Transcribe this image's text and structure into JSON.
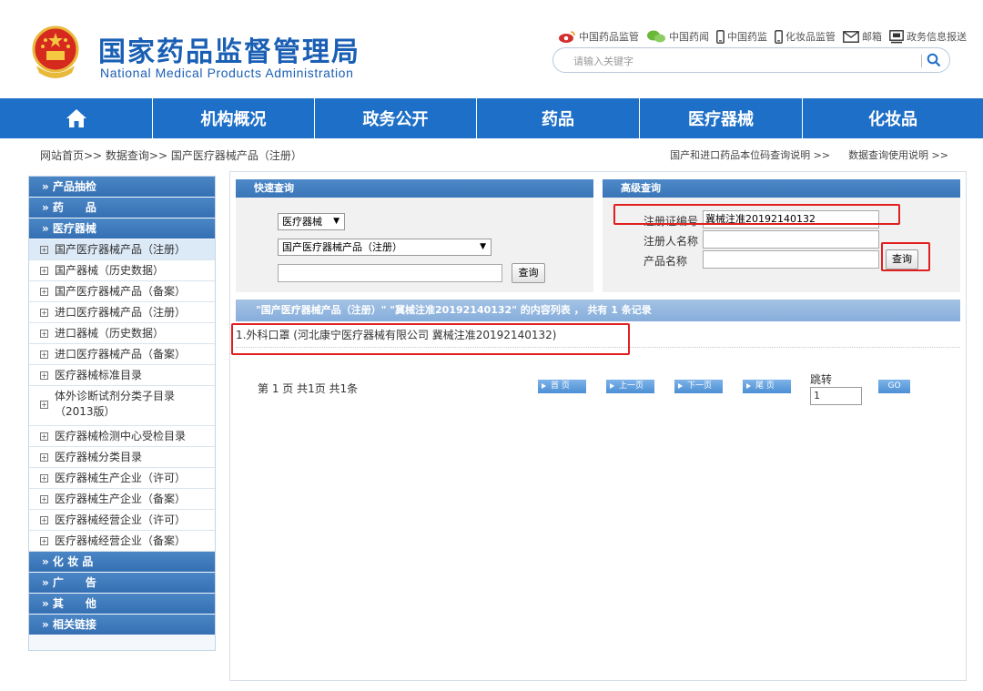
{
  "header": {
    "title": "国家药品监督管理局",
    "subtitle": "National Medical Products Administration",
    "links": [
      {
        "icon": "weibo-icon",
        "label": "中国药品监管"
      },
      {
        "icon": "wechat-icon",
        "label": "中国药闻"
      },
      {
        "icon": "mobile-icon",
        "label": "中国药监"
      },
      {
        "icon": "mobile-icon",
        "label": "化妆品监管"
      },
      {
        "icon": "mail-icon",
        "label": "邮箱"
      },
      {
        "icon": "report-icon",
        "label": "政务信息报送"
      }
    ],
    "search_placeholder": "请输入关键字"
  },
  "nav": {
    "items": [
      "机构概况",
      "政务公开",
      "药品",
      "医疗器械",
      "化妆品"
    ]
  },
  "breadcrumb": {
    "text": "网站首页>> 数据查询>> 国产医疗器械产品（注册）",
    "links": [
      "国产和进口药品本位码查询说明 >>",
      "数据查询使用说明 >>"
    ]
  },
  "sidebar": {
    "cat1": "» 产品抽检",
    "cat2": "» 药　　品",
    "cat3": "» 医疗器械",
    "items": [
      "国产医疗器械产品（注册）",
      "国产器械（历史数据）",
      "国产医疗器械产品（备案）",
      "进口医疗器械产品（注册）",
      "进口器械（历史数据）",
      "进口医疗器械产品（备案）",
      "医疗器械标准目录",
      "体外诊断试剂分类子目录（2013版）",
      "医疗器械检测中心受检目录",
      "医疗器械分类目录",
      "医疗器械生产企业（许可）",
      "医疗器械生产企业（备案）",
      "医疗器械经营企业（许可）",
      "医疗器械经营企业（备案）"
    ],
    "cat4": "» 化 妆 品",
    "cat5": "» 广　　告",
    "cat6": "» 其　　他",
    "cat7": "» 相关链接"
  },
  "quick": {
    "title": "快速查询",
    "select1": "医疗器械",
    "select2": "国产医疗器械产品（注册）",
    "input": "",
    "button": "查询"
  },
  "advanced": {
    "title": "高级查询",
    "label1": "注册证编号",
    "value1": "冀械注准20192140132",
    "label2": "注册人名称",
    "value2": "",
    "label3": "产品名称",
    "value3": "",
    "button": "查询"
  },
  "results": {
    "header": "\"国产医疗器械产品（注册）\" \"冀械注准20192140132\" 的内容列表 ， 共有 1 条记录",
    "row": "1.外科口罩 (河北康宁医疗器械有限公司 冀械注准20192140132)"
  },
  "pager": {
    "info": "第 1 页 共1页 共1条",
    "first": "首 页",
    "prev": "上一页",
    "next": "下一页",
    "last": "尾 页",
    "jump_label": "跳转",
    "jump_value": "1",
    "go": "GO"
  },
  "colors": {
    "nav_blue": "#1e6fc7",
    "brand_blue": "#1a5fb4",
    "highlight_red": "#e02020"
  }
}
